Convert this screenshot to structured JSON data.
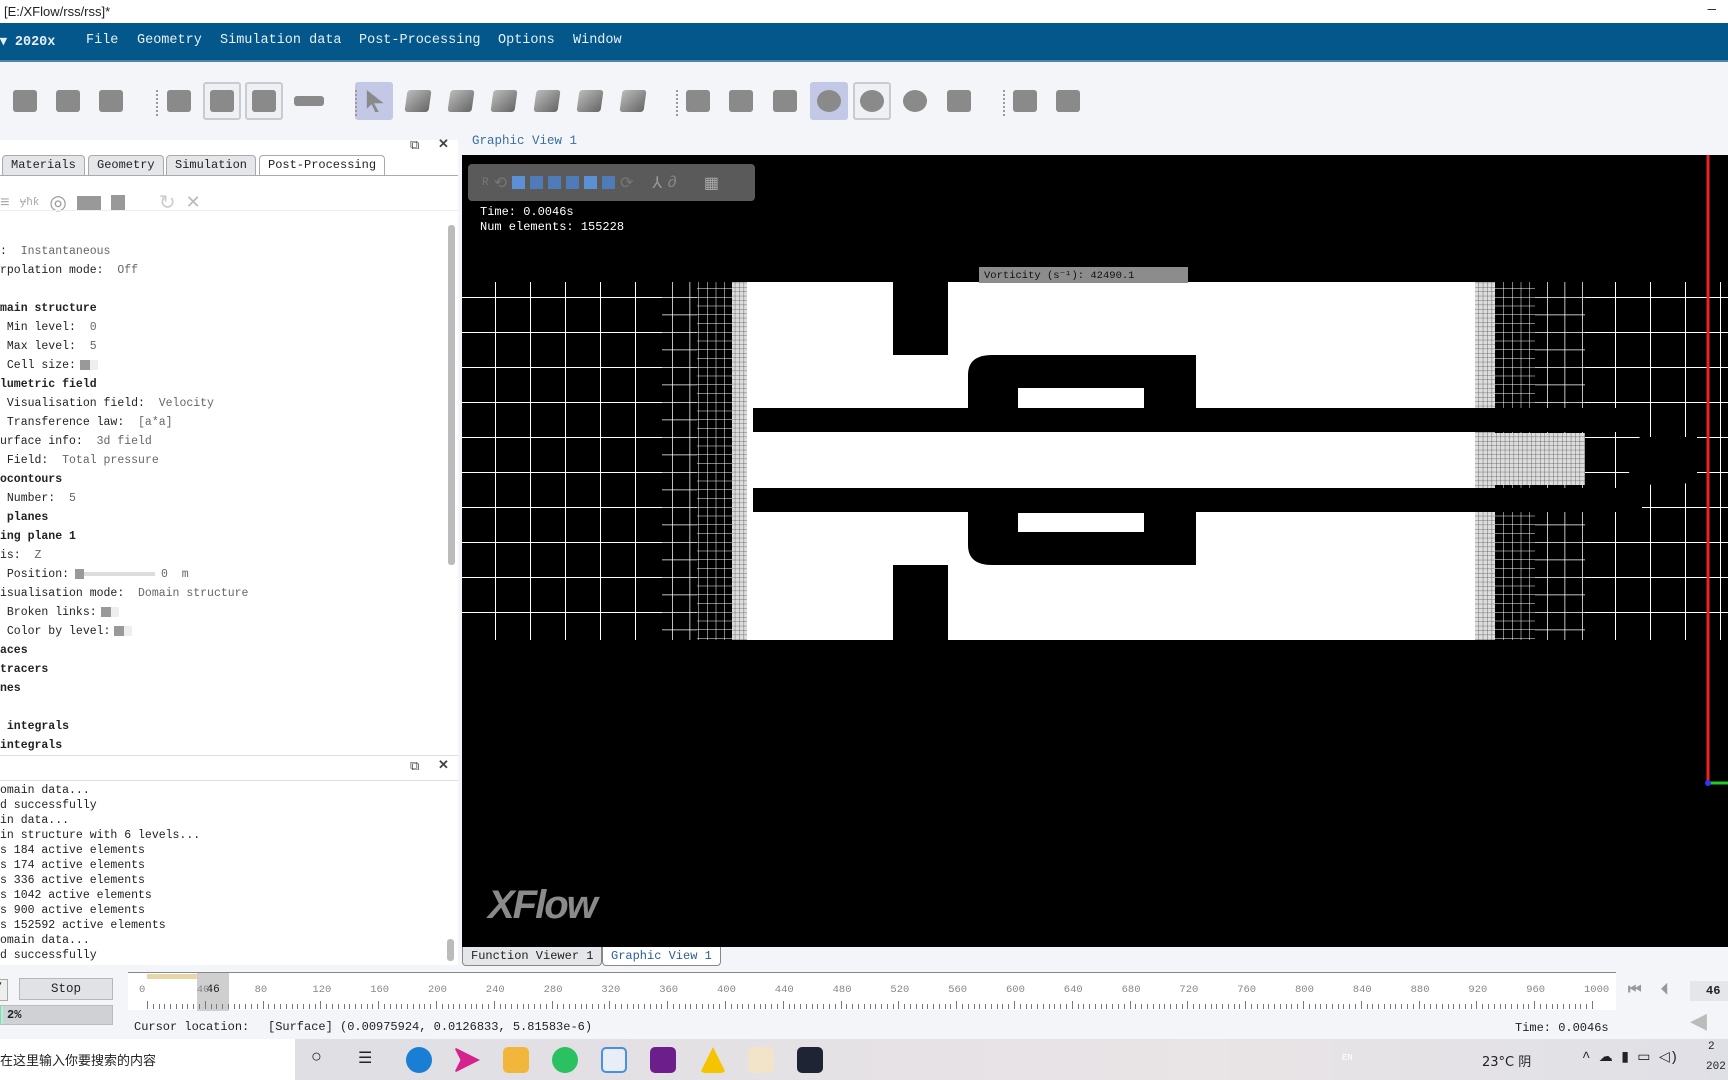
{
  "window": {
    "title": "[E:/XFlow/rss/rss]*",
    "minimize": "—"
  },
  "menu": {
    "app": "▾ 2020x",
    "items": [
      "File",
      "Geometry",
      "Simulation data",
      "Post-Processing",
      "Options",
      "Window"
    ]
  },
  "toolbar": {
    "icons": [
      "save-icon",
      "save-as-icon",
      "settings-gear-icon",
      "import-icon",
      "export-icon",
      "cube-view-icon",
      "ruler-icon",
      "select-arrow-icon",
      "select-cube-icon",
      "select-face-icon",
      "select-edge-icon",
      "select-solid-icon",
      "select-dark-icon",
      "select-vertex-icon",
      "mesh-transform-icon",
      "mesh-delete-icon",
      "probe-icon",
      "inspect-icon",
      "isosurface-icon",
      "target-icon",
      "video-clapper-icon",
      "box-icon",
      "wave-icon"
    ]
  },
  "left_panel": {
    "tabs": [
      "Materials",
      "Geometry",
      "Simulation",
      "Post-Processing"
    ],
    "active_tab": "Post-Processing",
    "tree": [
      {
        "label": ":  ",
        "value": "Instantaneous"
      },
      {
        "label": "rpolation mode:  ",
        "value": "Off"
      },
      {
        "label": ""
      },
      {
        "label": "main structure",
        "bold": true
      },
      {
        "label": " Min level:  ",
        "value": "0"
      },
      {
        "label": " Max level:  ",
        "value": "5"
      },
      {
        "label": " Cell size:",
        "check": true
      },
      {
        "label": "lumetric field",
        "bold": true
      },
      {
        "label": " Visualisation field:  ",
        "value": "Velocity"
      },
      {
        "label": " Transference law:  ",
        "value": "[a*a]"
      },
      {
        "label": "urface info:  ",
        "value": "3d field"
      },
      {
        "label": " Field:  ",
        "value": "Total pressure"
      },
      {
        "label": "ocontours",
        "bold": true
      },
      {
        "label": " Number:  ",
        "value": "5"
      },
      {
        "label": " planes",
        "bold": true
      },
      {
        "label": "ing plane 1",
        "bold": true
      },
      {
        "label": "is:  ",
        "value": "Z"
      },
      {
        "label": " Position:",
        "slider": 0,
        "value": "0  m"
      },
      {
        "label": "isualisation mode:  ",
        "value": "Domain structure"
      },
      {
        "label": " Broken links:",
        "check": true
      },
      {
        "label": " Color by level:",
        "check": true
      },
      {
        "label": "aces",
        "bold": true
      },
      {
        "label": "tracers",
        "bold": true
      },
      {
        "label": "nes",
        "bold": true
      },
      {
        "label": ""
      },
      {
        "label": " integrals",
        "bold": true
      },
      {
        "label": "integrals",
        "bold": true
      }
    ]
  },
  "output": {
    "lines": [
      "omain data...",
      "d successfully",
      "in data...",
      "in structure with 6 levels...",
      "s 184 active elements",
      "s 174 active elements",
      "s 336 active elements",
      "s 1042 active elements",
      "s 900 active elements",
      "s 152592 active elements",
      "omain data...",
      "d successfully"
    ]
  },
  "graphic_view": {
    "title": "Graphic View 1",
    "time": "Time: 0.0046s",
    "num_elements": "Num elements: 155228",
    "tooltip": "Vorticity (s⁻¹): 42490.1",
    "logo": "XFlow"
  },
  "bottom_tabs": [
    "Function Viewer 1",
    "Graphic View 1"
  ],
  "timeline": {
    "stop": "Stop",
    "progress": "2%",
    "progress_value": 2,
    "current": 46,
    "current_label": "46",
    "ticks": [
      0,
      40,
      80,
      120,
      160,
      200,
      240,
      280,
      320,
      360,
      400,
      440,
      480,
      520,
      560,
      600,
      640,
      680,
      720,
      760,
      800,
      840,
      880,
      920,
      960,
      1000
    ],
    "max": 1000,
    "frame_box": "46",
    "time": "Time: 0.0046s",
    "cursor_label": "Cursor location:",
    "cursor_value": "[Surface] (0.00975924, 0.0126833, 5.81583e-6)"
  },
  "taskbar": {
    "search": "在这里输入你要搜索的内容",
    "lang": "EN",
    "weather": "23°C 阴",
    "clock": "2",
    "date": "202"
  },
  "colors": {
    "menubar": "#03578a",
    "accent": "#3a6fa0"
  }
}
